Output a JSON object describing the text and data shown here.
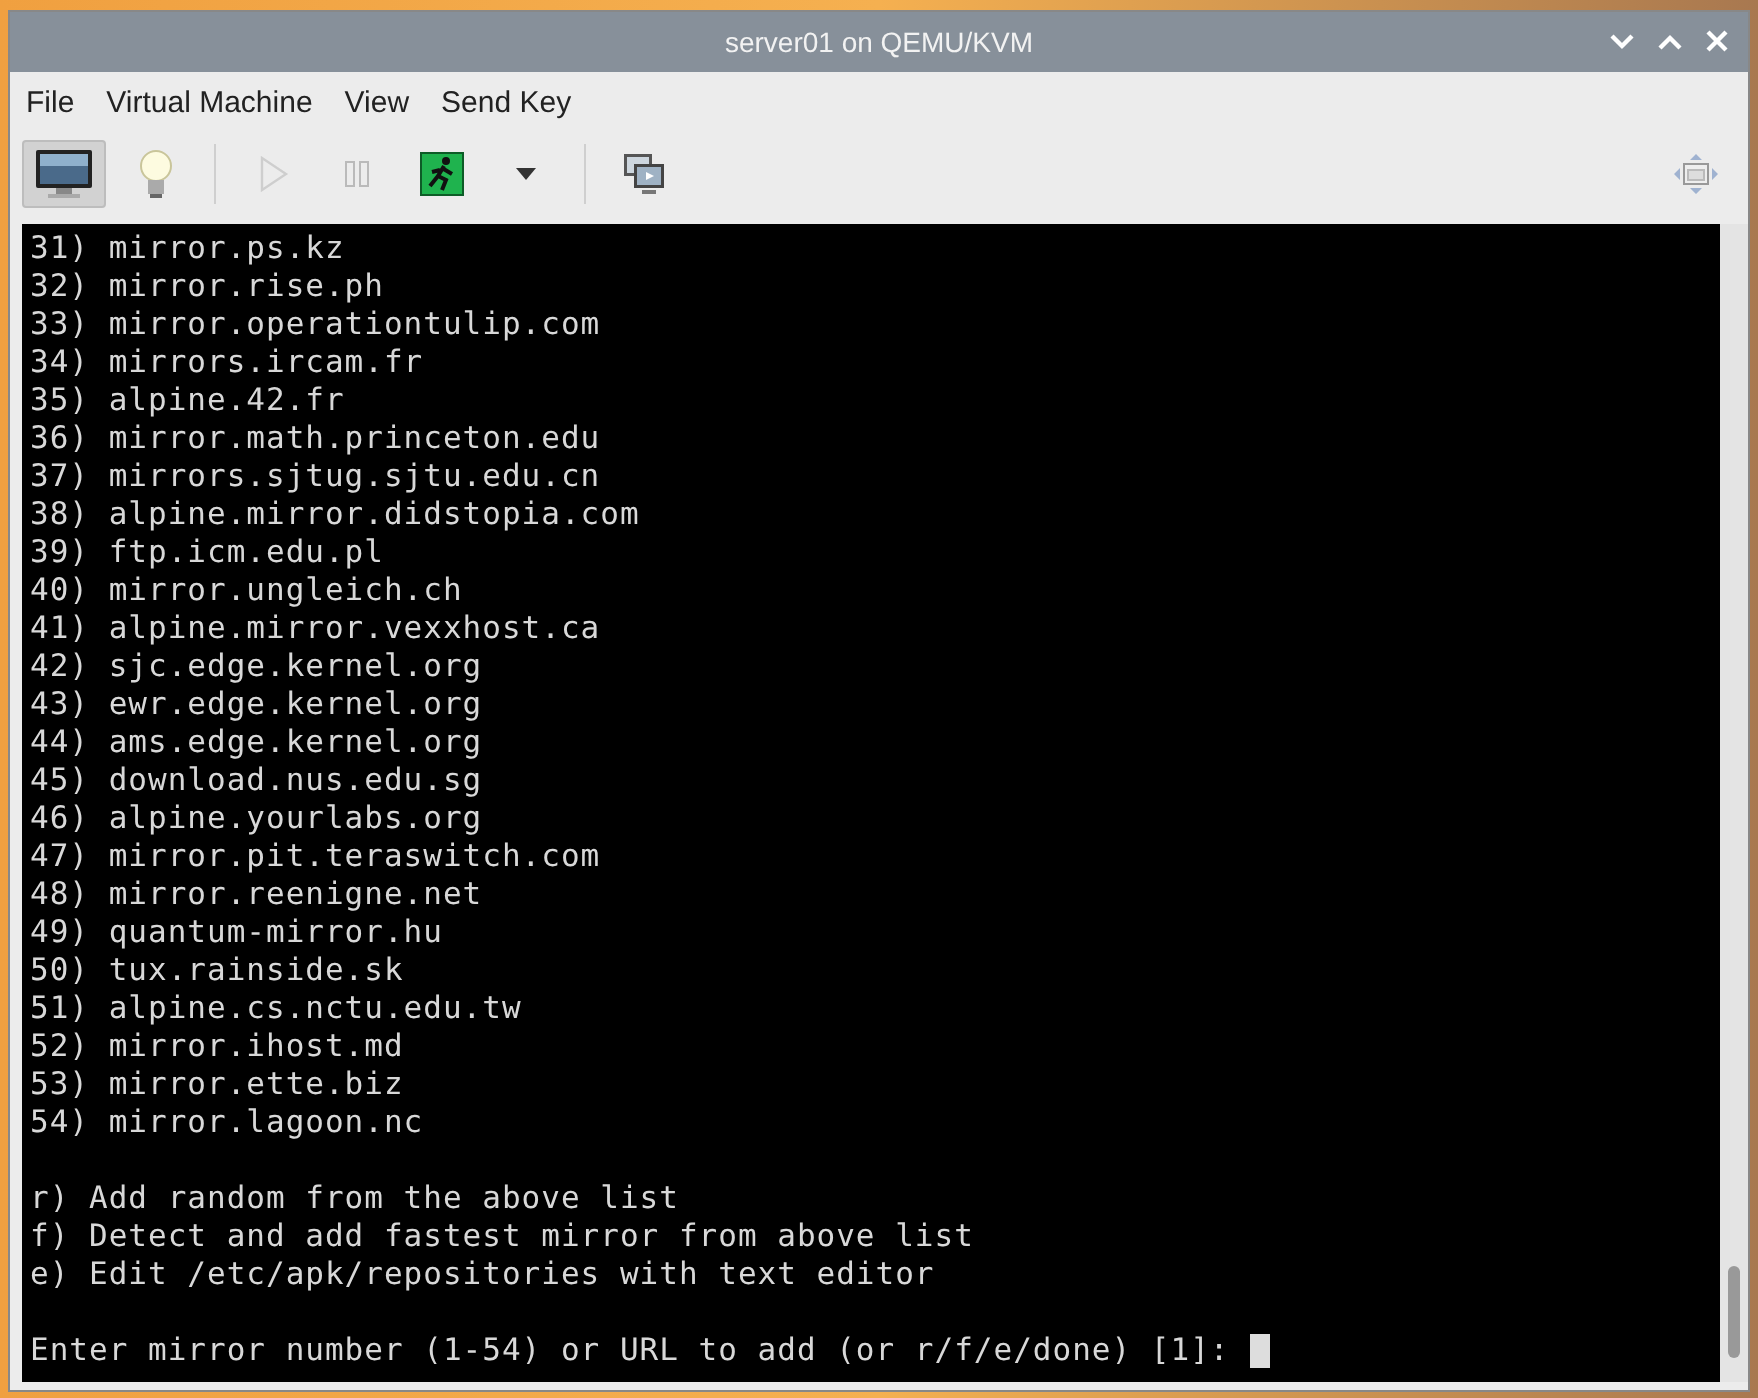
{
  "window": {
    "title": "server01 on QEMU/KVM"
  },
  "menu": [
    "File",
    "Virtual Machine",
    "View",
    "Send Key"
  ],
  "toolbar": [
    {
      "kind": "console",
      "selected": true
    },
    {
      "kind": "details",
      "selected": false
    },
    {
      "kind": "run",
      "disabled": true
    },
    {
      "kind": "pause",
      "disabled": true
    },
    {
      "kind": "shutdown",
      "disabled": false
    },
    {
      "kind": "dropdown",
      "disabled": false
    },
    {
      "kind": "snapshots",
      "disabled": false
    }
  ],
  "terminal": {
    "mirrors": [
      "31) mirror.ps.kz",
      "32) mirror.rise.ph",
      "33) mirror.operationtulip.com",
      "34) mirrors.ircam.fr",
      "35) alpine.42.fr",
      "36) mirror.math.princeton.edu",
      "37) mirrors.sjtug.sjtu.edu.cn",
      "38) alpine.mirror.didstopia.com",
      "39) ftp.icm.edu.pl",
      "40) mirror.ungleich.ch",
      "41) alpine.mirror.vexxhost.ca",
      "42) sjc.edge.kernel.org",
      "43) ewr.edge.kernel.org",
      "44) ams.edge.kernel.org",
      "45) download.nus.edu.sg",
      "46) alpine.yourlabs.org",
      "47) mirror.pit.teraswitch.com",
      "48) mirror.reenigne.net",
      "49) quantum-mirror.hu",
      "50) tux.rainside.sk",
      "51) alpine.cs.nctu.edu.tw",
      "52) mirror.ihost.md",
      "53) mirror.ette.biz",
      "54) mirror.lagoon.nc"
    ],
    "options": [
      "r) Add random from the above list",
      "f) Detect and add fastest mirror from above list",
      "e) Edit /etc/apk/repositories with text editor"
    ],
    "prompt": "Enter mirror number (1-54) or URL to add (or r/f/e/done) [1]: "
  }
}
